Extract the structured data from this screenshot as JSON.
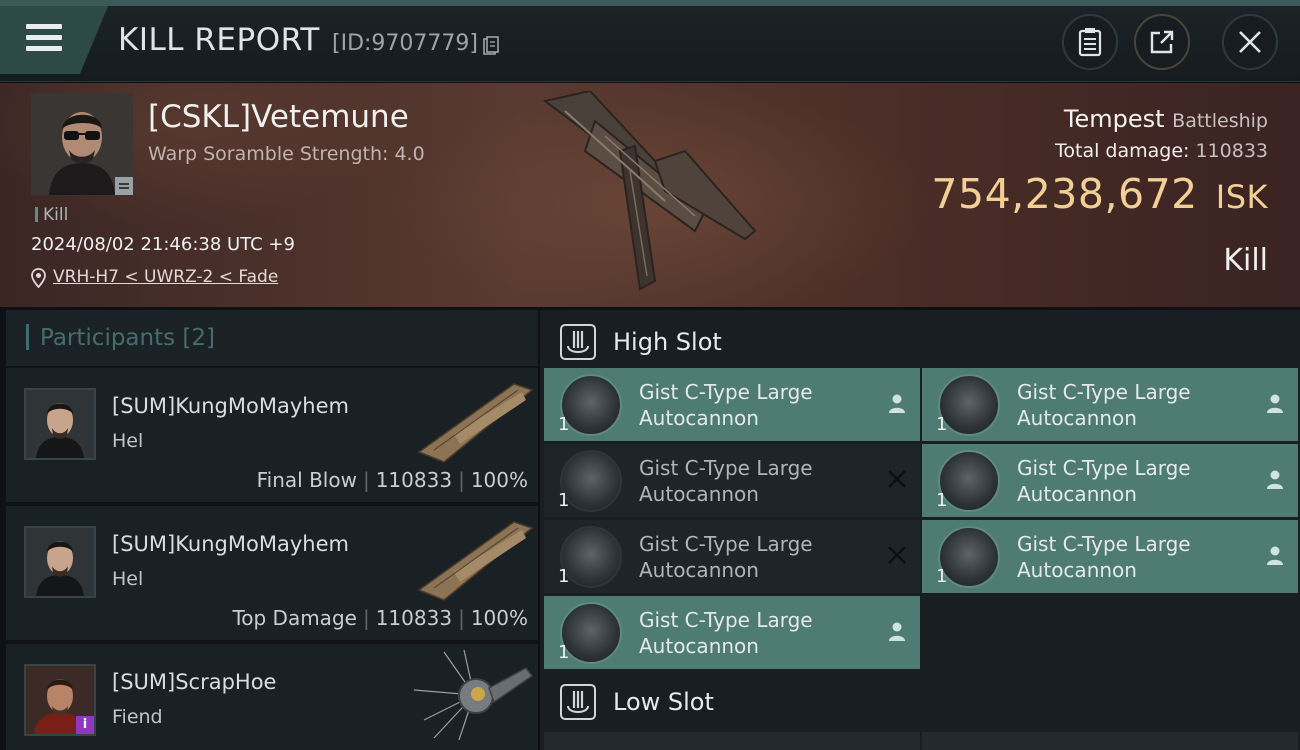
{
  "header": {
    "title": "KILL REPORT",
    "report_id": "[ID:9707779]"
  },
  "victim": {
    "name": "[CSKL]Vetemune",
    "subtitle": "Warp Soramble Strength: 4.0",
    "tag": "Kill",
    "datetime": "2024/08/02 21:46:38 UTC +9",
    "location": "VRH-H7 < UWRZ-2 < Fade",
    "ship_name": "Tempest",
    "ship_class": "Battleship",
    "total_damage_label": "Total damage:",
    "total_damage": "110833",
    "isk_value": "754,238,672",
    "isk_unit": "ISK",
    "result": "Kill"
  },
  "participants": {
    "label": "Participants",
    "count": "[2]",
    "items": [
      {
        "name": "[SUM]KungMoMayhem",
        "ship": "Hel",
        "role": "Final Blow",
        "damage": "110833",
        "percent": "100%"
      },
      {
        "name": "[SUM]KungMoMayhem",
        "ship": "Hel",
        "role": "Top Damage",
        "damage": "110833",
        "percent": "100%"
      },
      {
        "name": "[SUM]ScrapHoe",
        "ship": "Fiend",
        "info_badge": "i"
      }
    ]
  },
  "slots": {
    "high_label": "High Slot",
    "low_label": "Low Slot",
    "modules": [
      {
        "line1": "Gist C-Type Large",
        "line2": "Autocannon",
        "qty": "1",
        "status": "dropped"
      },
      {
        "line1": "Gist C-Type Large",
        "line2": "Autocannon",
        "qty": "1",
        "status": "dropped"
      },
      {
        "line1": "Gist C-Type Large",
        "line2": "Autocannon",
        "qty": "1",
        "status": "destroyed"
      },
      {
        "line1": "Gist C-Type Large",
        "line2": "Autocannon",
        "qty": "1",
        "status": "dropped"
      },
      {
        "line1": "Gist C-Type Large",
        "line2": "Autocannon",
        "qty": "1",
        "status": "destroyed"
      },
      {
        "line1": "Gist C-Type Large",
        "line2": "Autocannon",
        "qty": "1",
        "status": "dropped"
      },
      {
        "line1": "Gist C-Type Large",
        "line2": "Autocannon",
        "qty": "1",
        "status": "dropped"
      }
    ]
  },
  "colors": {
    "accent_teal": "#4e7b74",
    "isk_gold": "#f1cf95",
    "info_purple": "#8d37c2"
  },
  "icons": {
    "menu": "menu-icon",
    "copy": "copy-icon",
    "clipboard": "clipboard-icon",
    "share": "share-icon",
    "close": "close-icon",
    "pin": "location-pin-icon",
    "slot": "high-slot-icon",
    "dropped": "person-icon",
    "destroyed": "x-icon"
  }
}
